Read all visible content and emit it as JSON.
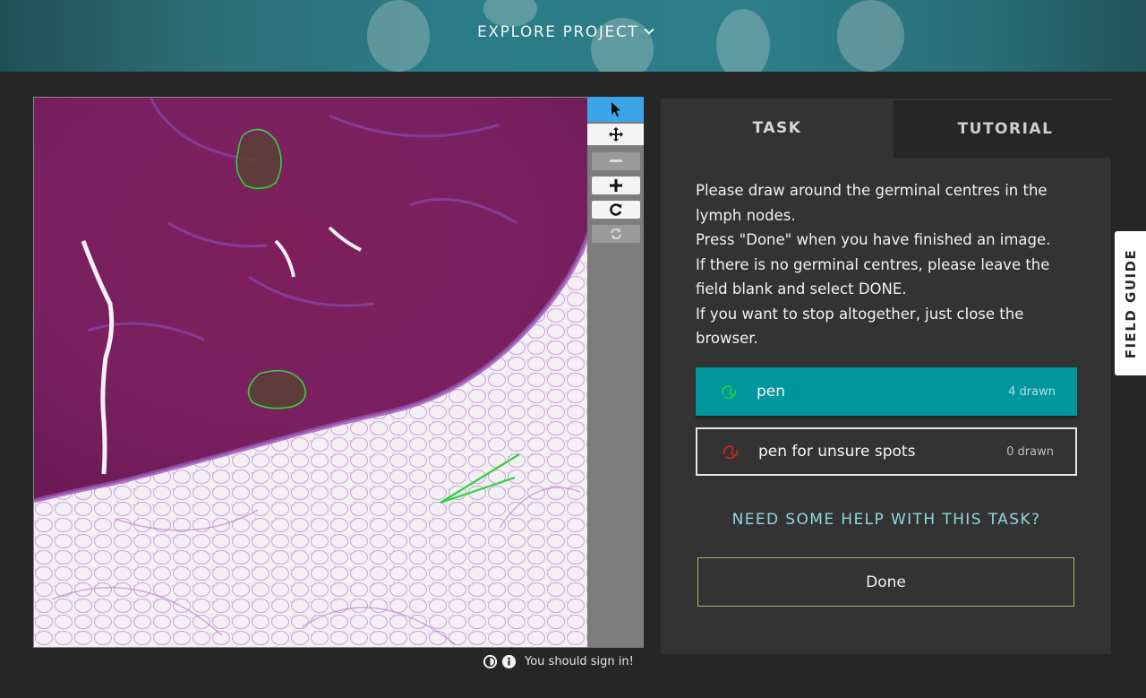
{
  "header": {
    "explore_label": "EXPLORE PROJECT"
  },
  "toolbar": {
    "tools": [
      "pointer-tool",
      "pan-tool",
      "zoom-out",
      "zoom-in",
      "reset-view",
      "rotate"
    ]
  },
  "footer": {
    "sign_in_text": "You should sign in!"
  },
  "task_panel": {
    "tabs": {
      "task": "TASK",
      "tutorial": "TUTORIAL"
    },
    "instructions": [
      "Please draw around the germinal centres in the lymph nodes.",
      "Press \"Done\" when you have finished an image.",
      "If there is no germinal centres, please leave the field blank and select DONE.",
      "If you want to stop altogether, just close the browser."
    ],
    "tools": [
      {
        "label": "pen",
        "count": "4 drawn",
        "color": "#2fd23a"
      },
      {
        "label": "pen for unsure spots",
        "count": "0 drawn",
        "color": "#e02020"
      }
    ],
    "help_label": "NEED SOME HELP WITH THIS TASK?",
    "done_label": "Done"
  },
  "field_guide": {
    "label": "FIELD GUIDE"
  },
  "colors": {
    "accent": "#00979c",
    "active_tool": "#3aa6e8",
    "annotation": "#2fd23a"
  }
}
